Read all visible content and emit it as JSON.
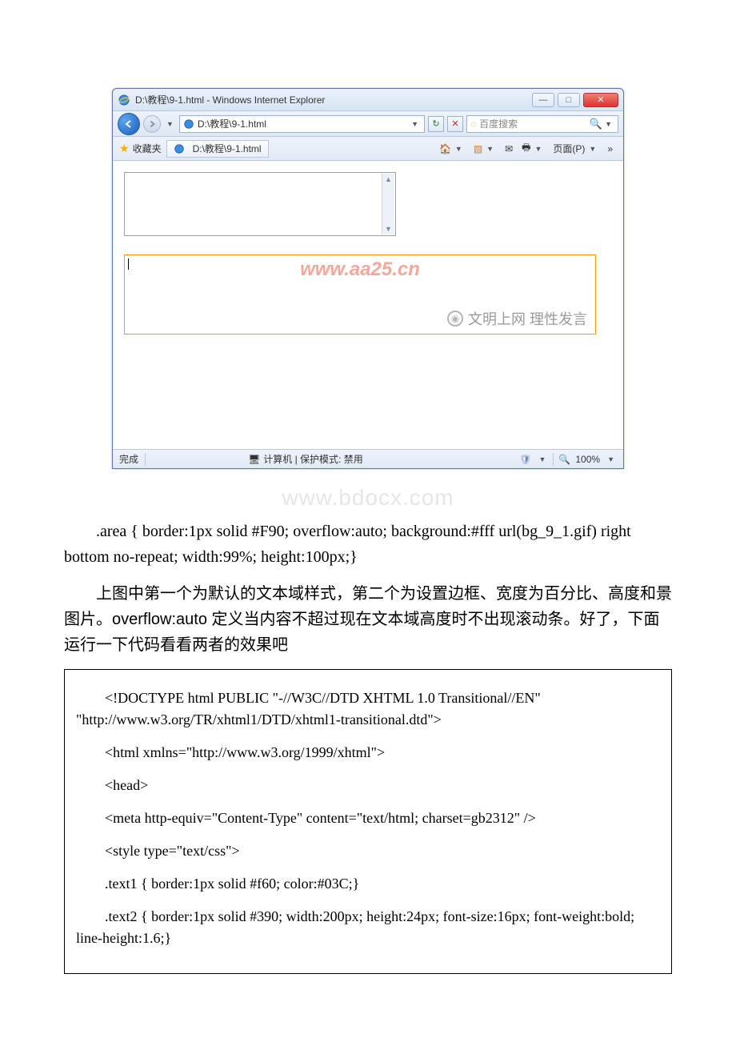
{
  "window": {
    "title": "D:\\教程\\9-1.html - Windows Internet Explorer",
    "address": "D:\\教程\\9-1.html",
    "search_placeholder": "百度搜索",
    "favorites_label": "收藏夹",
    "tab_label": "D:\\教程\\9-1.html",
    "page_menu": "页面(P)",
    "status_done": "完成",
    "status_zone": "计算机 | 保护模式: 禁用",
    "zoom": "100%"
  },
  "page": {
    "watermark1": "www.aa25.cn",
    "civilized": "文明上网 理性发言",
    "watermark2": "www.bdocx.com",
    "css_line": ".area { border:1px solid #F90; overflow:auto; background:#fff url(bg_9_1.gif) right bottom no-repeat; width:99%; height:100px;}",
    "paragraph": "上图中第一个为默认的文本域样式，第二个为设置边框、宽度为百分比、高度和景图片。overflow:auto 定义当内容不超过现在文本域高度时不出现滚动条。好了，下面运行一下代码看看两者的效果吧"
  },
  "code": {
    "l1": "<!DOCTYPE html PUBLIC \"-//W3C//DTD XHTML 1.0 Transitional//EN\" \"http://www.w3.org/TR/xhtml1/DTD/xhtml1-transitional.dtd\">",
    "l2": "<html xmlns=\"http://www.w3.org/1999/xhtml\">",
    "l3": "<head>",
    "l4": "<meta http-equiv=\"Content-Type\" content=\"text/html; charset=gb2312\" />",
    "l5": "<style type=\"text/css\">",
    "l6": ".text1 { border:1px solid #f60; color:#03C;}",
    "l7": ".text2 { border:1px solid #390; width:200px; height:24px; font-size:16px; font-weight:bold; line-height:1.6;}"
  }
}
